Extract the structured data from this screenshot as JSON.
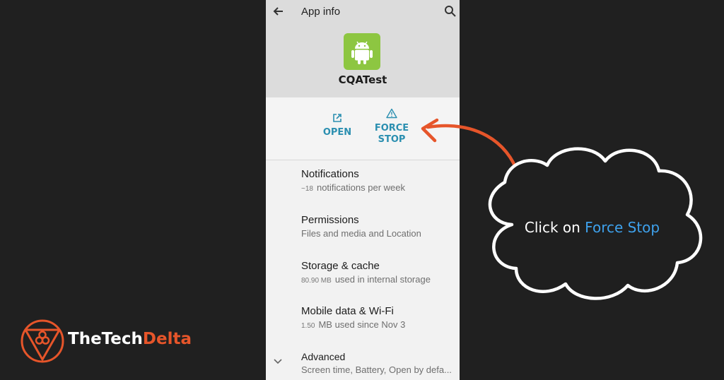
{
  "header": {
    "title": "App info"
  },
  "app": {
    "name": "CQATest"
  },
  "actions": {
    "open_label": "OPEN",
    "force_stop_label": "FORCE STOP"
  },
  "settings": [
    {
      "title": "Notifications",
      "count": "~18",
      "subtitle": "notifications per week"
    },
    {
      "title": "Permissions",
      "subtitle": "Files and media and Location"
    },
    {
      "title": "Storage & cache",
      "count": "80.90 MB",
      "subtitle": "used in internal storage"
    },
    {
      "title": "Mobile data & Wi-Fi",
      "count": "1.50",
      "subtitle": "MB used since Nov 3"
    },
    {
      "title": "Advanced",
      "subtitle": "Screen time, Battery, Open by defa..."
    }
  ],
  "callout": {
    "prefix": "Click on ",
    "highlight": "Force Stop"
  },
  "brand": {
    "part1": "TheTech",
    "part2": "Delta"
  },
  "icons": [
    "back-arrow-icon",
    "search-icon",
    "android-app-icon",
    "open-external-icon",
    "warning-icon",
    "chevron-down-icon",
    "brand-logo-icon"
  ],
  "colors": {
    "background": "#202020",
    "phone_bg": "#f2f2f2",
    "header_bg": "#dcdcdc",
    "action_blue": "#2b8fb0",
    "arrow_orange": "#e6552a",
    "highlight_blue": "#3ea1ec",
    "android_green": "#8dc641"
  }
}
